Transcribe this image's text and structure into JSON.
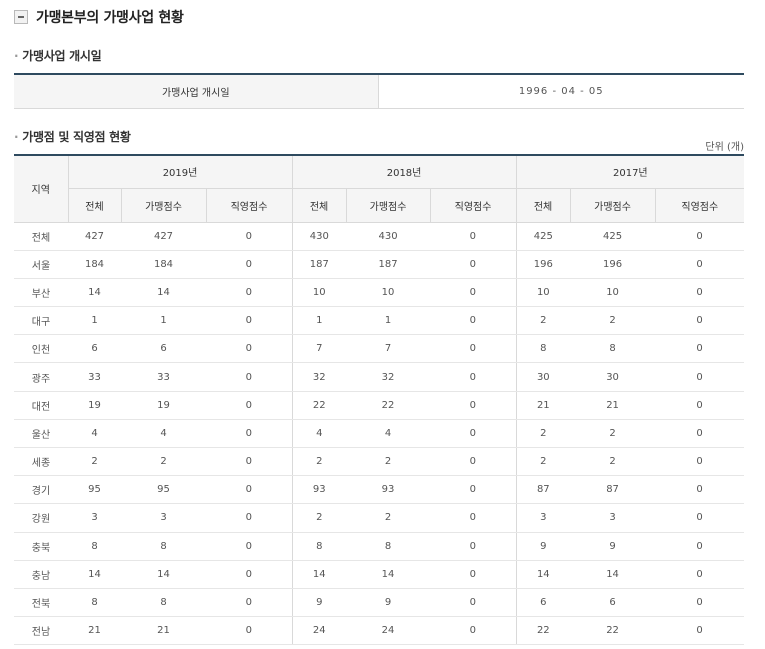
{
  "page": {
    "title": "가맹본부의 가맹사업 현황"
  },
  "section_open": {
    "title": "가맹사업 개시일",
    "label": "가맹사업 개시일",
    "value": "1996 - 04 - 05"
  },
  "section_stats": {
    "title": "가맹점 및 직영점 현황",
    "unit": "단위 (개)",
    "region_header": "지역",
    "years": [
      "2019년",
      "2018년",
      "2017년"
    ],
    "sub_headers": [
      "전체",
      "가맹점수",
      "직영점수"
    ],
    "rows": [
      {
        "region": "전체",
        "values": [
          "427",
          "427",
          "0",
          "430",
          "430",
          "0",
          "425",
          "425",
          "0"
        ]
      },
      {
        "region": "서울",
        "values": [
          "184",
          "184",
          "0",
          "187",
          "187",
          "0",
          "196",
          "196",
          "0"
        ]
      },
      {
        "region": "부산",
        "values": [
          "14",
          "14",
          "0",
          "10",
          "10",
          "0",
          "10",
          "10",
          "0"
        ]
      },
      {
        "region": "대구",
        "values": [
          "1",
          "1",
          "0",
          "1",
          "1",
          "0",
          "2",
          "2",
          "0"
        ]
      },
      {
        "region": "인천",
        "values": [
          "6",
          "6",
          "0",
          "7",
          "7",
          "0",
          "8",
          "8",
          "0"
        ]
      },
      {
        "region": "광주",
        "values": [
          "33",
          "33",
          "0",
          "32",
          "32",
          "0",
          "30",
          "30",
          "0"
        ]
      },
      {
        "region": "대전",
        "values": [
          "19",
          "19",
          "0",
          "22",
          "22",
          "0",
          "21",
          "21",
          "0"
        ]
      },
      {
        "region": "울산",
        "values": [
          "4",
          "4",
          "0",
          "4",
          "4",
          "0",
          "2",
          "2",
          "0"
        ]
      },
      {
        "region": "세종",
        "values": [
          "2",
          "2",
          "0",
          "2",
          "2",
          "0",
          "2",
          "2",
          "0"
        ]
      },
      {
        "region": "경기",
        "values": [
          "95",
          "95",
          "0",
          "93",
          "93",
          "0",
          "87",
          "87",
          "0"
        ]
      },
      {
        "region": "강원",
        "values": [
          "3",
          "3",
          "0",
          "2",
          "2",
          "0",
          "3",
          "3",
          "0"
        ]
      },
      {
        "region": "충북",
        "values": [
          "8",
          "8",
          "0",
          "8",
          "8",
          "0",
          "9",
          "9",
          "0"
        ]
      },
      {
        "region": "충남",
        "values": [
          "14",
          "14",
          "0",
          "14",
          "14",
          "0",
          "14",
          "14",
          "0"
        ]
      },
      {
        "region": "전북",
        "values": [
          "8",
          "8",
          "0",
          "9",
          "9",
          "0",
          "6",
          "6",
          "0"
        ]
      },
      {
        "region": "전남",
        "values": [
          "21",
          "21",
          "0",
          "24",
          "24",
          "0",
          "22",
          "22",
          "0"
        ]
      }
    ]
  }
}
